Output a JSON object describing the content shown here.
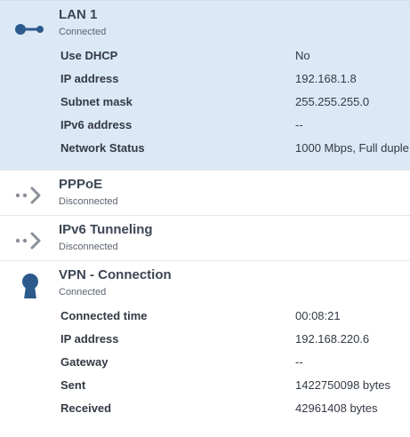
{
  "interfaces": [
    {
      "title": "LAN 1",
      "status": "Connected",
      "icon": "ethernet-plug-icon",
      "selected": true,
      "details": [
        {
          "label": "Use DHCP",
          "value": "No"
        },
        {
          "label": "IP address",
          "value": "192.168.1.8"
        },
        {
          "label": "Subnet mask",
          "value": "255.255.255.0"
        },
        {
          "label": "IPv6 address",
          "value": "--"
        },
        {
          "label": "Network Status",
          "value": "1000 Mbps, Full duple"
        }
      ]
    },
    {
      "title": "PPPoE",
      "status": "Disconnected",
      "icon": "dotted-arrow-icon"
    },
    {
      "title": "IPv6 Tunneling",
      "status": "Disconnected",
      "icon": "dotted-arrow-icon"
    },
    {
      "title": "VPN - Connection",
      "status": "Connected",
      "icon": "keyhole-icon",
      "details": [
        {
          "label": "Connected time",
          "value": "00:08:21"
        },
        {
          "label": "IP address",
          "value": "192.168.220.6"
        },
        {
          "label": "Gateway",
          "value": "--"
        },
        {
          "label": "Sent",
          "value": "1422750098 bytes"
        },
        {
          "label": "Received",
          "value": "42961408 bytes"
        }
      ]
    }
  ],
  "colors": {
    "selected_bg": "#dbe8f6",
    "icon_blue": "#2c5a8c",
    "icon_gray": "#8a9099"
  }
}
